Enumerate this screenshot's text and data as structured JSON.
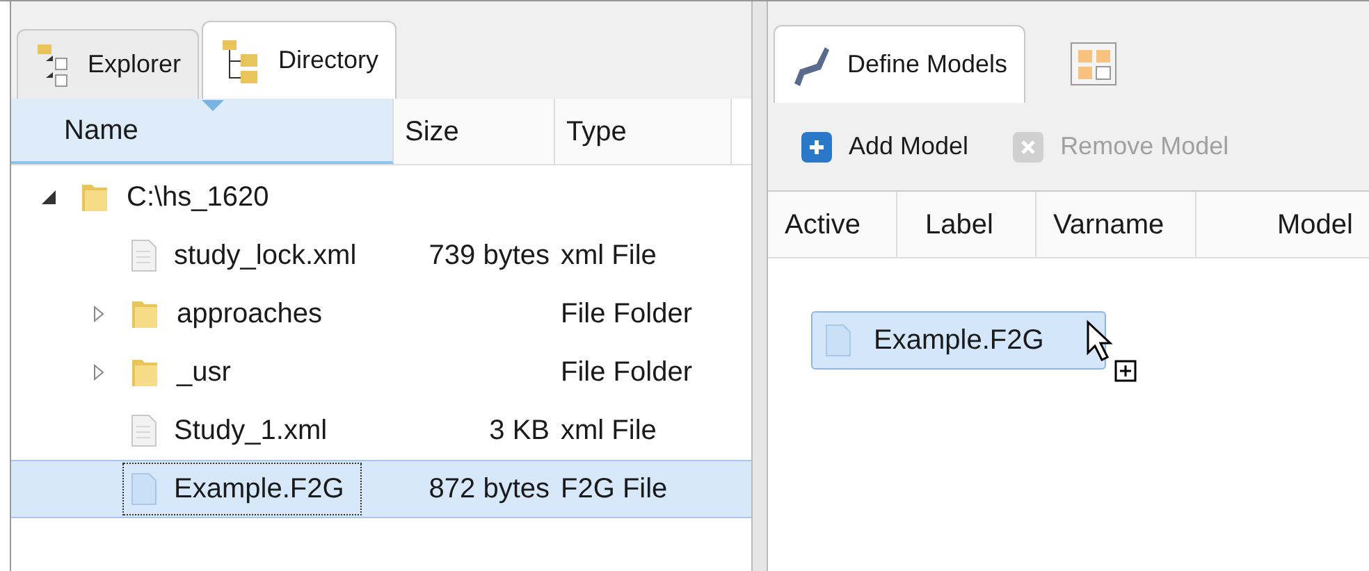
{
  "left_panel": {
    "tabs": [
      {
        "label": "Explorer",
        "selected": false
      },
      {
        "label": "Directory",
        "selected": true
      }
    ],
    "table": {
      "columns": [
        "Name",
        "Size",
        "Type"
      ],
      "rows": [
        {
          "kind": "folder",
          "name": "C:\\hs_1620",
          "expanded": true,
          "selected": false,
          "children": [
            {
              "kind": "file",
              "name": "study_lock.xml",
              "size": "739 bytes",
              "type": "xml File",
              "selected": false
            },
            {
              "kind": "folder",
              "name": "approaches",
              "type": "File Folder",
              "expanded": false,
              "selected": false
            },
            {
              "kind": "folder",
              "name": "_usr",
              "type": "File Folder",
              "expanded": false,
              "selected": false
            },
            {
              "kind": "file",
              "name": "Study_1.xml",
              "size": "3 KB",
              "type": "xml File",
              "selected": false
            },
            {
              "kind": "f2g",
              "name": "Example.F2G",
              "size": "872 bytes",
              "type": "F2G File",
              "selected": true
            }
          ]
        }
      ]
    }
  },
  "right_panel": {
    "tabs": [
      {
        "label": "Define Models",
        "selected": true
      }
    ],
    "toolbar": [
      {
        "label": "Add Model",
        "disabled": false
      },
      {
        "label": "Remove Model",
        "disabled": true
      }
    ],
    "table": {
      "columns": [
        "Active",
        "Label",
        "Varname",
        "Model"
      ]
    },
    "drag_item": {
      "label": "Example.F2G"
    }
  }
}
